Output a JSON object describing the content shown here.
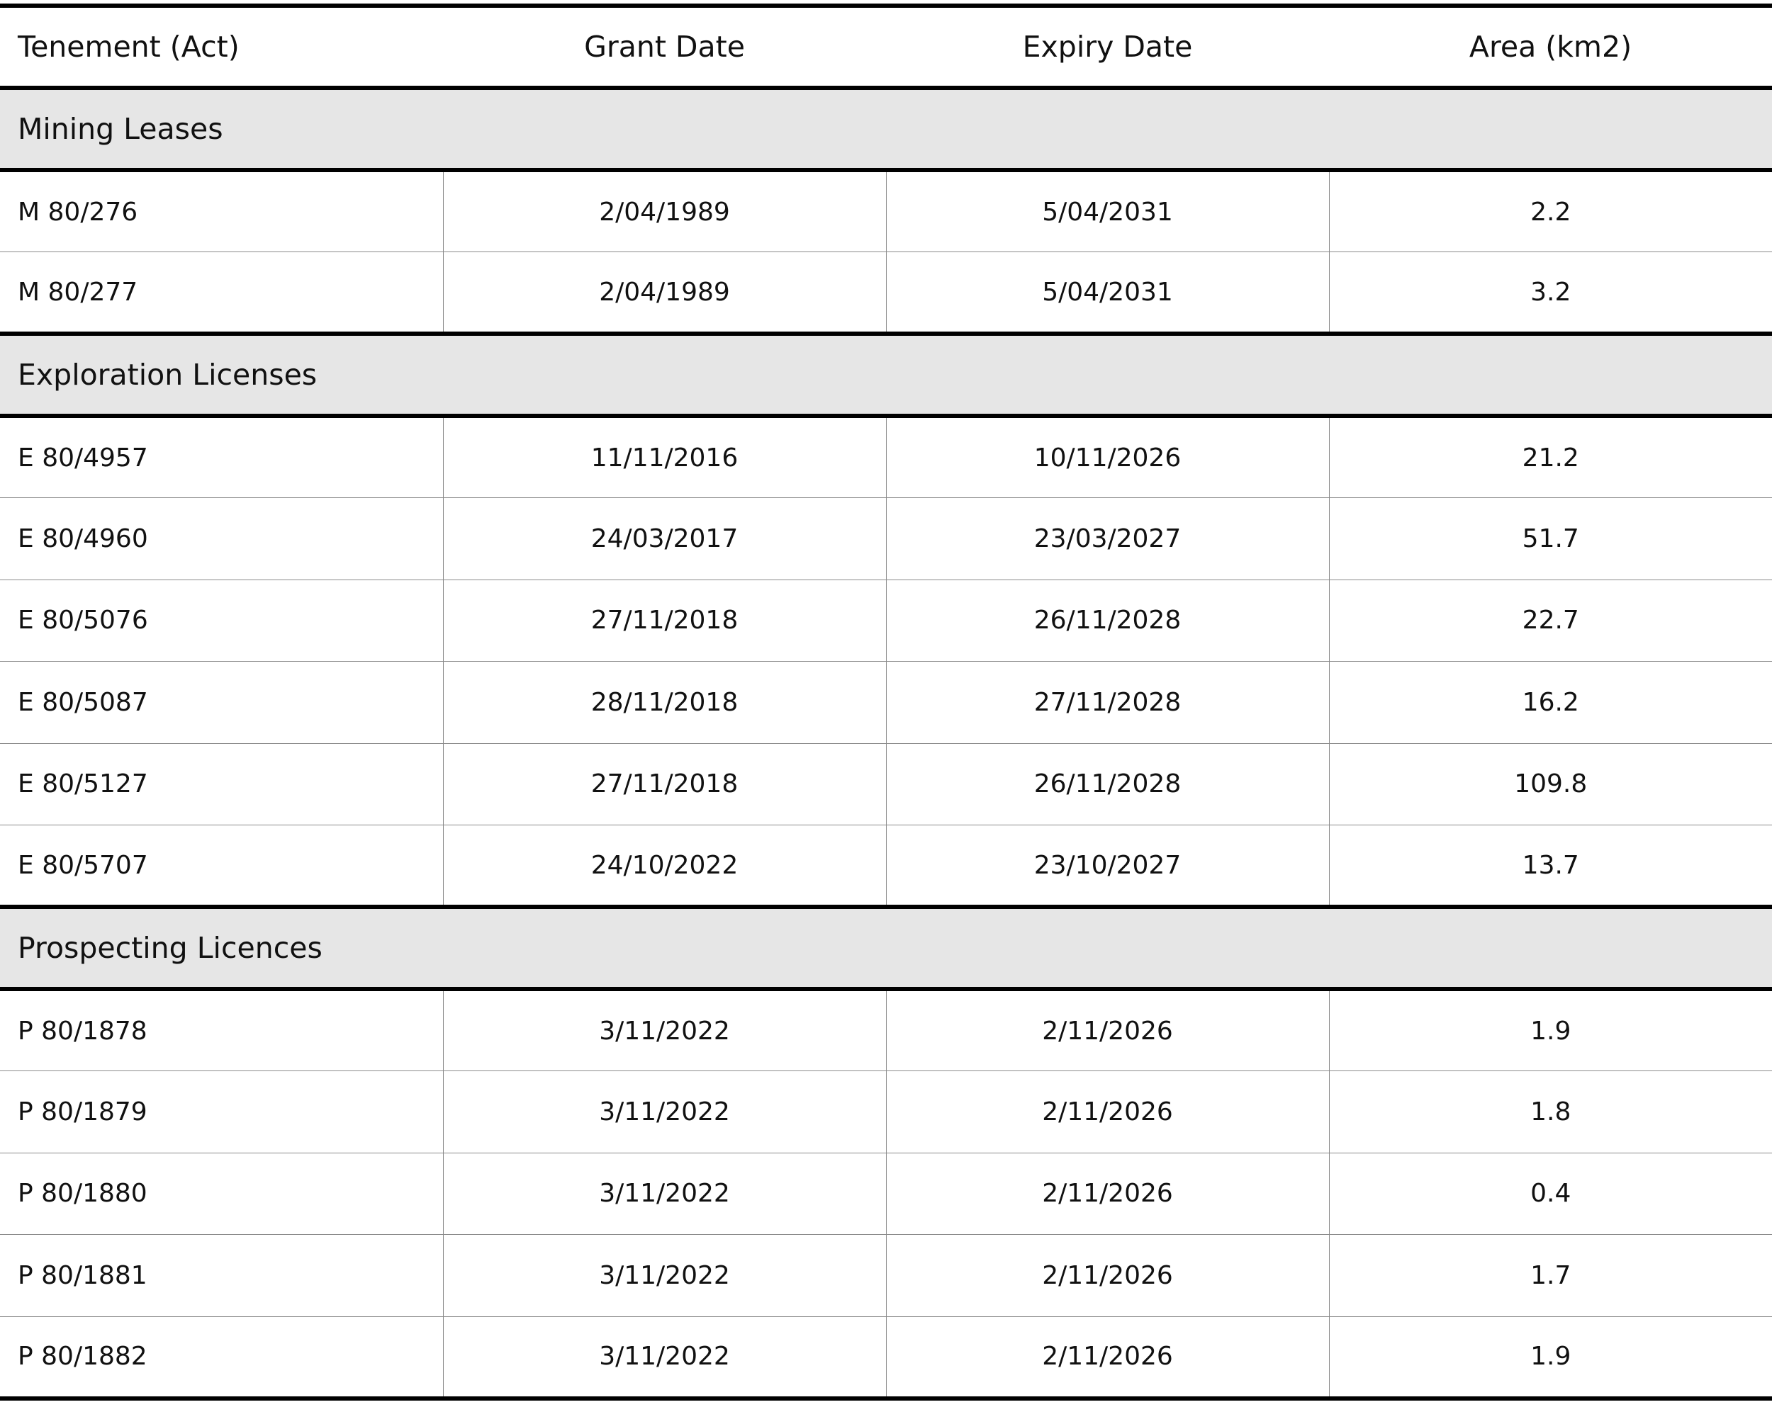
{
  "table": {
    "headers": [
      "Tenement (Act)",
      "Grant Date",
      "Expiry Date",
      "Area (km2)"
    ],
    "sections": [
      {
        "title": "Mining Leases",
        "rows": [
          [
            "M 80/276",
            "2/04/1989",
            "5/04/2031",
            "2.2"
          ],
          [
            "M 80/277",
            "2/04/1989",
            "5/04/2031",
            "3.2"
          ]
        ]
      },
      {
        "title": "Exploration Licenses",
        "rows": [
          [
            "E 80/4957",
            "11/11/2016",
            "10/11/2026",
            "21.2"
          ],
          [
            "E 80/4960",
            "24/03/2017",
            "23/03/2027",
            "51.7"
          ],
          [
            "E 80/5076",
            "27/11/2018",
            "26/11/2028",
            "22.7"
          ],
          [
            "E 80/5087",
            "28/11/2018",
            "27/11/2028",
            "16.2"
          ],
          [
            "E 80/5127",
            "27/11/2018",
            "26/11/2028",
            "109.8"
          ],
          [
            "E 80/5707",
            "24/10/2022",
            "23/10/2027",
            "13.7"
          ]
        ]
      },
      {
        "title": "Prospecting Licences",
        "rows": [
          [
            "P 80/1878",
            "3/11/2022",
            "2/11/2026",
            "1.9"
          ],
          [
            "P 80/1879",
            "3/11/2022",
            "2/11/2026",
            "1.8"
          ],
          [
            "P 80/1880",
            "3/11/2022",
            "2/11/2026",
            "0.4"
          ],
          [
            "P 80/1881",
            "3/11/2022",
            "2/11/2026",
            "1.7"
          ],
          [
            "P 80/1882",
            "3/11/2022",
            "2/11/2026",
            "1.9"
          ]
        ]
      }
    ]
  }
}
